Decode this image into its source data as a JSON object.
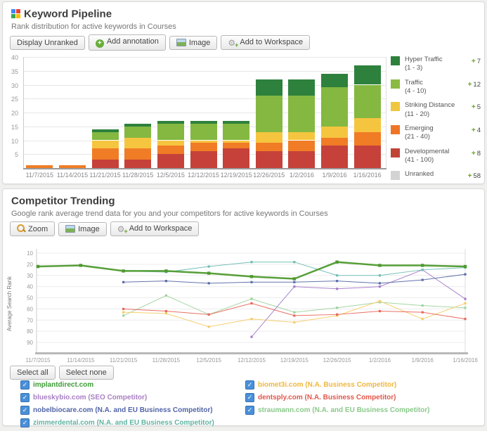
{
  "panel1": {
    "title": "Keyword Pipeline",
    "subtitle": "Rank distribution for active keywords in Courses",
    "buttons": [
      {
        "name": "display-unranked-button",
        "label": "Display Unranked",
        "icon": null
      },
      {
        "name": "add-annotation-button",
        "label": "Add annotation",
        "icon": "plus-circle-icon"
      },
      {
        "name": "image-button",
        "label": "Image",
        "icon": "image-icon"
      },
      {
        "name": "add-to-workspace-button",
        "label": "Add to Workspace",
        "icon": "workspace-gear-icon"
      }
    ],
    "legend": [
      {
        "label": "Hyper Traffic",
        "range": "(1 - 3)",
        "delta": "7",
        "color": "#2e813d"
      },
      {
        "label": "Traffic",
        "range": "(4 - 10)",
        "delta": "12",
        "color": "#8aba41"
      },
      {
        "label": "Striking Distance",
        "range": "(11 - 20)",
        "delta": "5",
        "color": "#f0c63f"
      },
      {
        "label": "Emerging",
        "range": "(21 - 40)",
        "delta": "4",
        "color": "#ee7527"
      },
      {
        "label": "Developmental",
        "range": "(41 - 100)",
        "delta": "8",
        "color": "#c04338"
      },
      {
        "label": "Unranked",
        "range": "",
        "delta": "58",
        "color": "#d3d3d3"
      }
    ]
  },
  "panel2": {
    "title": "Competitor Trending",
    "subtitle": "Google rank average trend data for you and your competitors for active keywords in Courses",
    "buttons": [
      {
        "name": "zoom-button",
        "label": "Zoom",
        "icon": "zoom-magnifier-icon"
      },
      {
        "name": "image-button",
        "label": "Image",
        "icon": "image-icon"
      },
      {
        "name": "add-to-workspace-button",
        "label": "Add to Workspace",
        "icon": "workspace-gear-icon"
      }
    ],
    "select_buttons": [
      {
        "name": "select-all-button",
        "label": "Select all"
      },
      {
        "name": "select-none-button",
        "label": "Select none"
      }
    ],
    "checkbox_legend": {
      "left": [
        {
          "label": "implantdirect.com",
          "color": "#3d9b35",
          "checked": true
        },
        {
          "label": "blueskybio.com (SEO Competitor)",
          "color": "#a87fc3",
          "checked": true
        },
        {
          "label": "nobelbiocare.com (N.A. and EU Business Competitor)",
          "color": "#5265a8",
          "checked": true
        },
        {
          "label": "zimmerdental.com (N.A. and EU Business Competitor)",
          "color": "#5fb3a1",
          "checked": true
        }
      ],
      "right": [
        {
          "label": "biomet3i.com (N.A. Business Competitor)",
          "color": "#efb73d",
          "checked": true
        },
        {
          "label": "dentsply.com (N.A. Business Competitor)",
          "color": "#e2574b",
          "checked": true
        },
        {
          "label": "straumann.com (N.A. and EU Business Competitor)",
          "color": "#8bc98b",
          "checked": true
        }
      ]
    }
  },
  "chart_data": [
    {
      "type": "bar",
      "stacked": true,
      "title": "Keyword Pipeline rank distribution",
      "categories": [
        "11/7/2015",
        "11/14/2015",
        "11/21/2015",
        "11/28/2015",
        "12/5/2015",
        "12/12/2015",
        "12/19/2015",
        "12/26/2015",
        "1/2/2016",
        "1/9/2016",
        "1/16/2016"
      ],
      "series": [
        {
          "name": "Developmental (41 - 100)",
          "color": "#c5413a",
          "values": [
            0,
            0,
            3,
            3,
            5,
            6,
            7,
            6,
            6,
            8,
            8
          ]
        },
        {
          "name": "Emerging (21 - 40)",
          "color": "#f07c26",
          "values": [
            1,
            1,
            4,
            4,
            3,
            3,
            2,
            3,
            4,
            3,
            5
          ]
        },
        {
          "name": "Striking Distance (11 - 20)",
          "color": "#f6c53f",
          "values": [
            0,
            0,
            3,
            4,
            2,
            1,
            1,
            4,
            3,
            4,
            5
          ]
        },
        {
          "name": "Traffic (4 - 10)",
          "color": "#84b841",
          "values": [
            0,
            0,
            3,
            4,
            6,
            6,
            6,
            13,
            13,
            14,
            12
          ]
        },
        {
          "name": "Hyper Traffic (1 - 3)",
          "color": "#2e813d",
          "values": [
            0,
            0,
            1,
            1,
            1,
            1,
            1,
            6,
            6,
            5,
            7
          ]
        }
      ],
      "ylim": [
        0,
        40
      ],
      "yticks": [
        5,
        10,
        15,
        20,
        25,
        30,
        35,
        40
      ],
      "grid": true,
      "legend_position": "right"
    },
    {
      "type": "line",
      "title": "Competitor Trending",
      "ylabel": "Average Search Rank",
      "y_inverted": true,
      "ylim": [
        10,
        90
      ],
      "yticks": [
        10,
        20,
        30,
        40,
        50,
        60,
        70,
        80,
        90
      ],
      "x": [
        "11/7/2015",
        "11/14/2015",
        "11/21/2015",
        "11/28/2015",
        "12/5/2015",
        "12/12/2015",
        "12/19/2015",
        "12/26/2015",
        "1/2/2016",
        "1/9/2016",
        "1/16/2016"
      ],
      "series": [
        {
          "name": "straumann.com",
          "color": "#9fd49f",
          "width": 1,
          "values": [
            null,
            null,
            66,
            48,
            65,
            51,
            63,
            59,
            54,
            57,
            59
          ]
        },
        {
          "name": "biomet3i.com",
          "color": "#f5cd6a",
          "width": 1,
          "values": [
            null,
            null,
            63,
            64,
            76,
            69,
            72,
            66,
            53,
            69,
            55
          ]
        },
        {
          "name": "dentsply.com",
          "color": "#e8685c",
          "width": 1,
          "values": [
            null,
            null,
            60,
            62,
            65,
            55,
            66,
            65,
            62,
            63,
            69
          ]
        },
        {
          "name": "blueskybio.com",
          "color": "#a77bc9",
          "width": 1,
          "values": [
            null,
            null,
            null,
            null,
            null,
            85,
            40,
            42,
            40,
            25,
            51
          ]
        },
        {
          "name": "nobelbiocare.com",
          "color": "#5b6da8",
          "width": 1,
          "values": [
            null,
            null,
            36,
            35,
            37,
            36,
            36,
            35,
            37,
            34,
            29
          ]
        },
        {
          "name": "zimmerdental.com",
          "color": "#6fbdb3",
          "width": 1,
          "values": [
            null,
            null,
            26,
            27,
            22,
            18,
            18,
            30,
            30,
            25,
            23
          ]
        },
        {
          "name": "implantdirect.com",
          "color": "#4e9a2e",
          "width": 2.5,
          "values": [
            22,
            21,
            26,
            26,
            28,
            31,
            33,
            18,
            21,
            21,
            22
          ]
        }
      ],
      "grid": true
    }
  ]
}
